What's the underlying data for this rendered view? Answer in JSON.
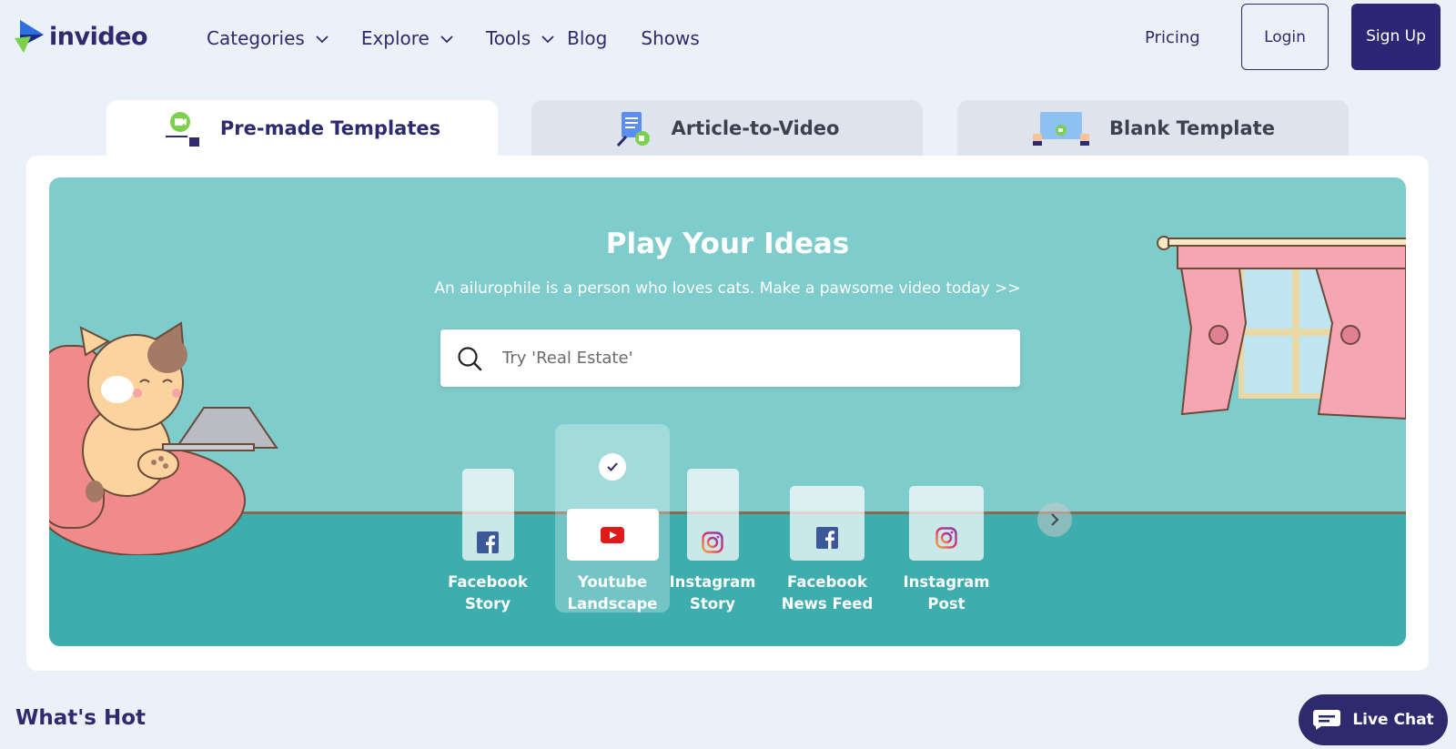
{
  "header": {
    "logo_text": "invideo",
    "nav": [
      {
        "label": "Categories",
        "dropdown": true
      },
      {
        "label": "Explore",
        "dropdown": true
      },
      {
        "label": "Tools",
        "dropdown": true
      },
      {
        "label": "Blog",
        "dropdown": false
      },
      {
        "label": "Shows",
        "dropdown": false
      }
    ],
    "pricing": "Pricing",
    "login": "Login",
    "signup": "Sign Up"
  },
  "tabs": [
    {
      "label": "Pre-made Templates",
      "active": true
    },
    {
      "label": "Article-to-Video",
      "active": false
    },
    {
      "label": "Blank Template",
      "active": false
    }
  ],
  "hero": {
    "title": "Play Your Ideas",
    "subtitle": "An ailurophile is a person who loves cats. Make a pawsome video today >>",
    "search_placeholder": "Try 'Real Estate'"
  },
  "formats": [
    {
      "label": "Facebook\nStory",
      "icon": "facebook-icon",
      "selected": false
    },
    {
      "label": "Youtube\nLandscape",
      "icon": "youtube-icon",
      "selected": true
    },
    {
      "label": "Instagram\nStory",
      "icon": "instagram-icon",
      "selected": false
    },
    {
      "label": "Facebook\nNews Feed",
      "icon": "facebook-icon",
      "selected": false
    },
    {
      "label": "Instagram\nPost",
      "icon": "instagram-icon",
      "selected": false
    }
  ],
  "section_title": "What's Hot",
  "livechat": "Live Chat",
  "colors": {
    "brand_navy": "#2d2a6e",
    "signup_bg": "#2b2775",
    "hero_bg": "#7ecdcc",
    "hero_floor": "#3eadad",
    "page_bg": "#ebf1f9"
  }
}
